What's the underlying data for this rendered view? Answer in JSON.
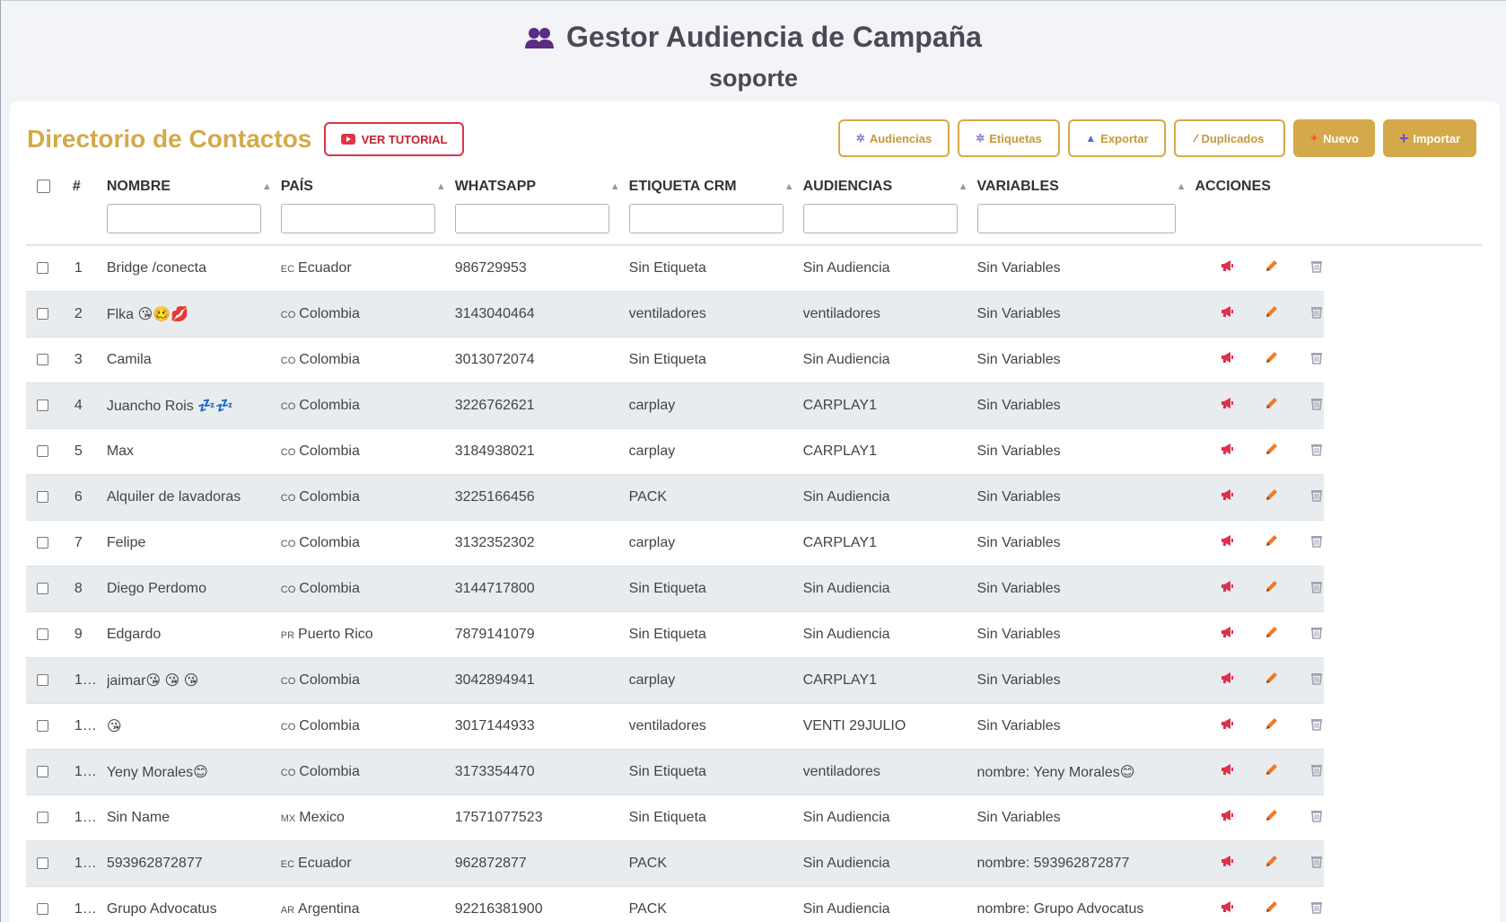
{
  "header": {
    "title": "Gestor Audiencia de Campaña",
    "subtitle": "soporte"
  },
  "toolbar": {
    "section_title": "Directorio de Contactos",
    "tutorial_label": "VER TUTORIAL",
    "buttons": {
      "audiencias": "Audiencias",
      "etiquetas": "Etiquetas",
      "exportar": "Exportar",
      "duplicados": "Duplicados",
      "nuevo": "Nuevo",
      "importar": "Importar"
    }
  },
  "table": {
    "headers": {
      "num": "#",
      "nombre": "NOMBRE",
      "pais": "PAÍS",
      "whatsapp": "WHATSAPP",
      "etiqueta": "ETIQUETA CRM",
      "audiencias": "AUDIENCIAS",
      "variables": "VARIABLES",
      "acciones": "ACCIONES"
    },
    "rows": [
      {
        "num": "1",
        "nombre": "Bridge /conecta",
        "cc": "EC",
        "pais": "Ecuador",
        "whatsapp": "986729953",
        "etiqueta": "Sin Etiqueta",
        "audiencia": "Sin Audiencia",
        "variables": "Sin Variables"
      },
      {
        "num": "2",
        "nombre": "Flka 😘🥴💋",
        "cc": "CO",
        "pais": "Colombia",
        "whatsapp": "3143040464",
        "etiqueta": "ventiladores",
        "audiencia": "ventiladores",
        "variables": "Sin Variables"
      },
      {
        "num": "3",
        "nombre": "Camila",
        "cc": "CO",
        "pais": "Colombia",
        "whatsapp": "3013072074",
        "etiqueta": "Sin Etiqueta",
        "audiencia": "Sin Audiencia",
        "variables": "Sin Variables"
      },
      {
        "num": "4",
        "nombre": "Juancho Rois 💤💤",
        "cc": "CO",
        "pais": "Colombia",
        "whatsapp": "3226762621",
        "etiqueta": "carplay",
        "audiencia": "CARPLAY1",
        "variables": "Sin Variables"
      },
      {
        "num": "5",
        "nombre": "Max",
        "cc": "CO",
        "pais": "Colombia",
        "whatsapp": "3184938021",
        "etiqueta": "carplay",
        "audiencia": "CARPLAY1",
        "variables": "Sin Variables"
      },
      {
        "num": "6",
        "nombre": "Alquiler de lavadoras",
        "cc": "CO",
        "pais": "Colombia",
        "whatsapp": "3225166456",
        "etiqueta": "PACK",
        "audiencia": "Sin Audiencia",
        "variables": "Sin Variables"
      },
      {
        "num": "7",
        "nombre": "Felipe",
        "cc": "CO",
        "pais": "Colombia",
        "whatsapp": "3132352302",
        "etiqueta": "carplay",
        "audiencia": "CARPLAY1",
        "variables": "Sin Variables"
      },
      {
        "num": "8",
        "nombre": "Diego Perdomo",
        "cc": "CO",
        "pais": "Colombia",
        "whatsapp": "3144717800",
        "etiqueta": "Sin Etiqueta",
        "audiencia": "Sin Audiencia",
        "variables": "Sin Variables"
      },
      {
        "num": "9",
        "nombre": "Edgardo",
        "cc": "PR",
        "pais": "Puerto Rico",
        "whatsapp": "7879141079",
        "etiqueta": "Sin Etiqueta",
        "audiencia": "Sin Audiencia",
        "variables": "Sin Variables"
      },
      {
        "num": "1…",
        "nombre": "jaimar😘 😘 😘",
        "cc": "CO",
        "pais": "Colombia",
        "whatsapp": "3042894941",
        "etiqueta": "carplay",
        "audiencia": "CARPLAY1",
        "variables": "Sin Variables"
      },
      {
        "num": "1…",
        "nombre": "😘",
        "cc": "CO",
        "pais": "Colombia",
        "whatsapp": "3017144933",
        "etiqueta": "ventiladores",
        "audiencia": "VENTI 29JULIO",
        "variables": "Sin Variables"
      },
      {
        "num": "1…",
        "nombre": "Yeny Morales😊",
        "cc": "CO",
        "pais": "Colombia",
        "whatsapp": "3173354470",
        "etiqueta": "Sin Etiqueta",
        "audiencia": "ventiladores",
        "variables": "nombre: Yeny Morales😊"
      },
      {
        "num": "1…",
        "nombre": "Sin Name",
        "cc": "MX",
        "pais": "Mexico",
        "whatsapp": "17571077523",
        "etiqueta": "Sin Etiqueta",
        "audiencia": "Sin Audiencia",
        "variables": "Sin Variables"
      },
      {
        "num": "1…",
        "nombre": "593962872877",
        "cc": "EC",
        "pais": "Ecuador",
        "whatsapp": "962872877",
        "etiqueta": "PACK",
        "audiencia": "Sin Audiencia",
        "variables": "nombre: 593962872877"
      },
      {
        "num": "1…",
        "nombre": "Grupo Advocatus",
        "cc": "AR",
        "pais": "Argentina",
        "whatsapp": "92216381900",
        "etiqueta": "PACK",
        "audiencia": "Sin Audiencia",
        "variables": "nombre: Grupo Advocatus"
      }
    ]
  },
  "icons": {
    "header": "users-icon",
    "tutorial": "youtube-icon",
    "audiencias": "gear-icon",
    "etiquetas": "gear-icon",
    "exportar": "export-icon",
    "duplicados": "broom-icon",
    "nuevo": "star-icon",
    "importar": "plus-icon",
    "row_actions": [
      "megaphone-icon",
      "pencil-icon",
      "trash-icon"
    ]
  },
  "colors": {
    "accent": "#d4a94a",
    "danger": "#dc3545",
    "stripe": "#e9ecef"
  }
}
